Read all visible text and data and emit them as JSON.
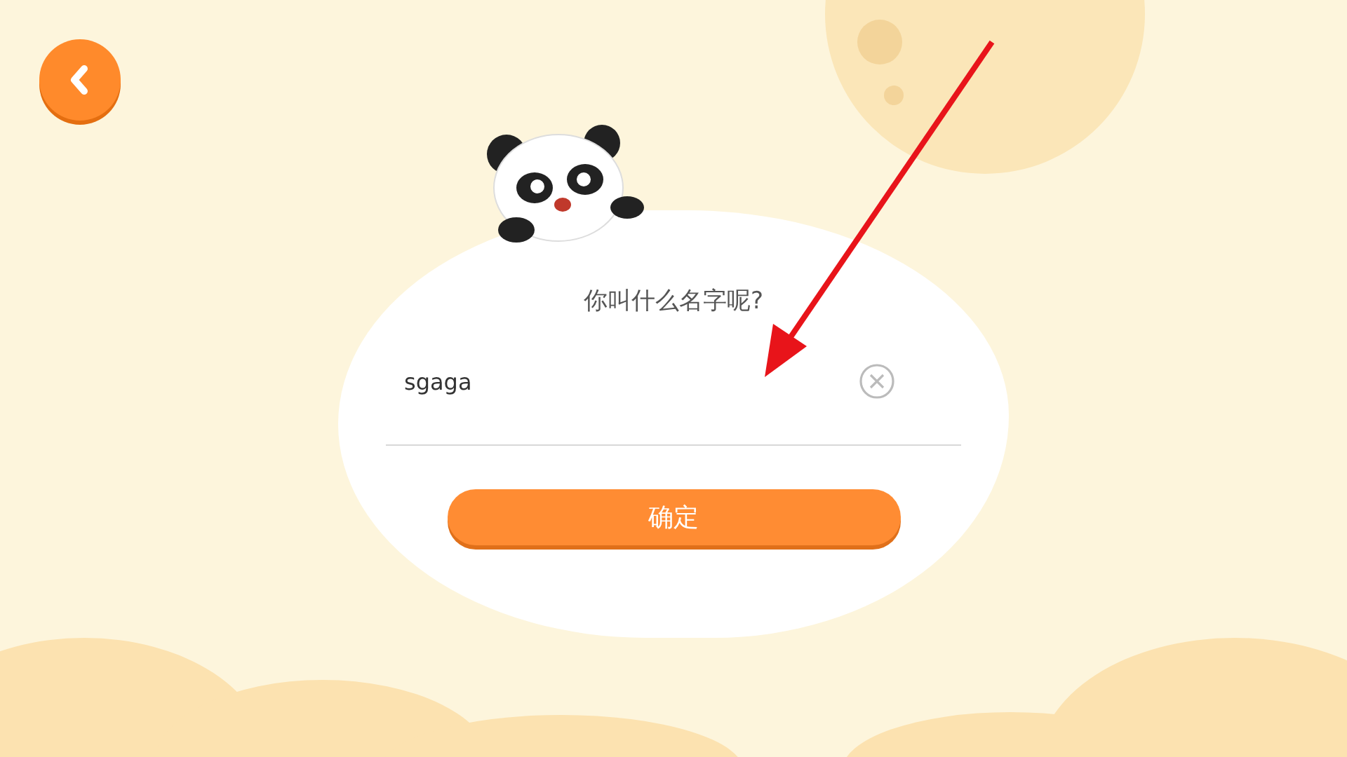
{
  "prompt": "你叫什么名字呢?",
  "name_field": {
    "value": "sgaga"
  },
  "confirm_button": {
    "label": "确定"
  }
}
